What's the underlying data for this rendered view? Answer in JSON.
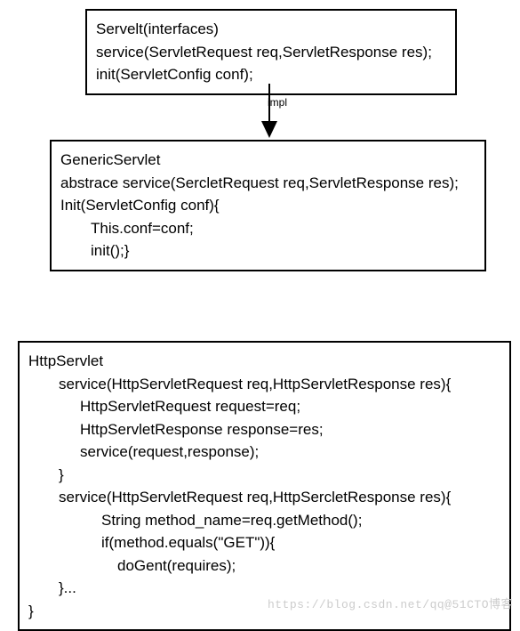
{
  "box1": {
    "l1": "Servelt(interfaces)",
    "l2": "service(ServletRequest req,ServletResponse res);",
    "l3": "init(ServletConfig conf);"
  },
  "arrow": {
    "label": "impl"
  },
  "box2": {
    "l1": "GenericServlet",
    "l2": "abstrace service(SercletRequest req,ServletResponse res);",
    "l3": "Init(ServletConfig conf){",
    "l4": "This.conf=conf;",
    "l5": "init();}"
  },
  "box3": {
    "l1": "HttpServlet",
    "l2": "service(HttpServletRequest req,HttpServletResponse res){",
    "l3": "HttpServletRequest request=req;",
    "l4": "HttpServletResponse response=res;",
    "l5": "service(request,response);",
    "l6": "}",
    "l7": "service(HttpServletRequest req,HttpSercletResponse res){",
    "l8": "String method_name=req.getMethod();",
    "l9": "if(method.equals(\"GET\")){",
    "l10": "doGent(requires);",
    "l11": "}...",
    "l12": "}"
  },
  "watermark": "https://blog.csdn.net/qq@51CTO博客"
}
